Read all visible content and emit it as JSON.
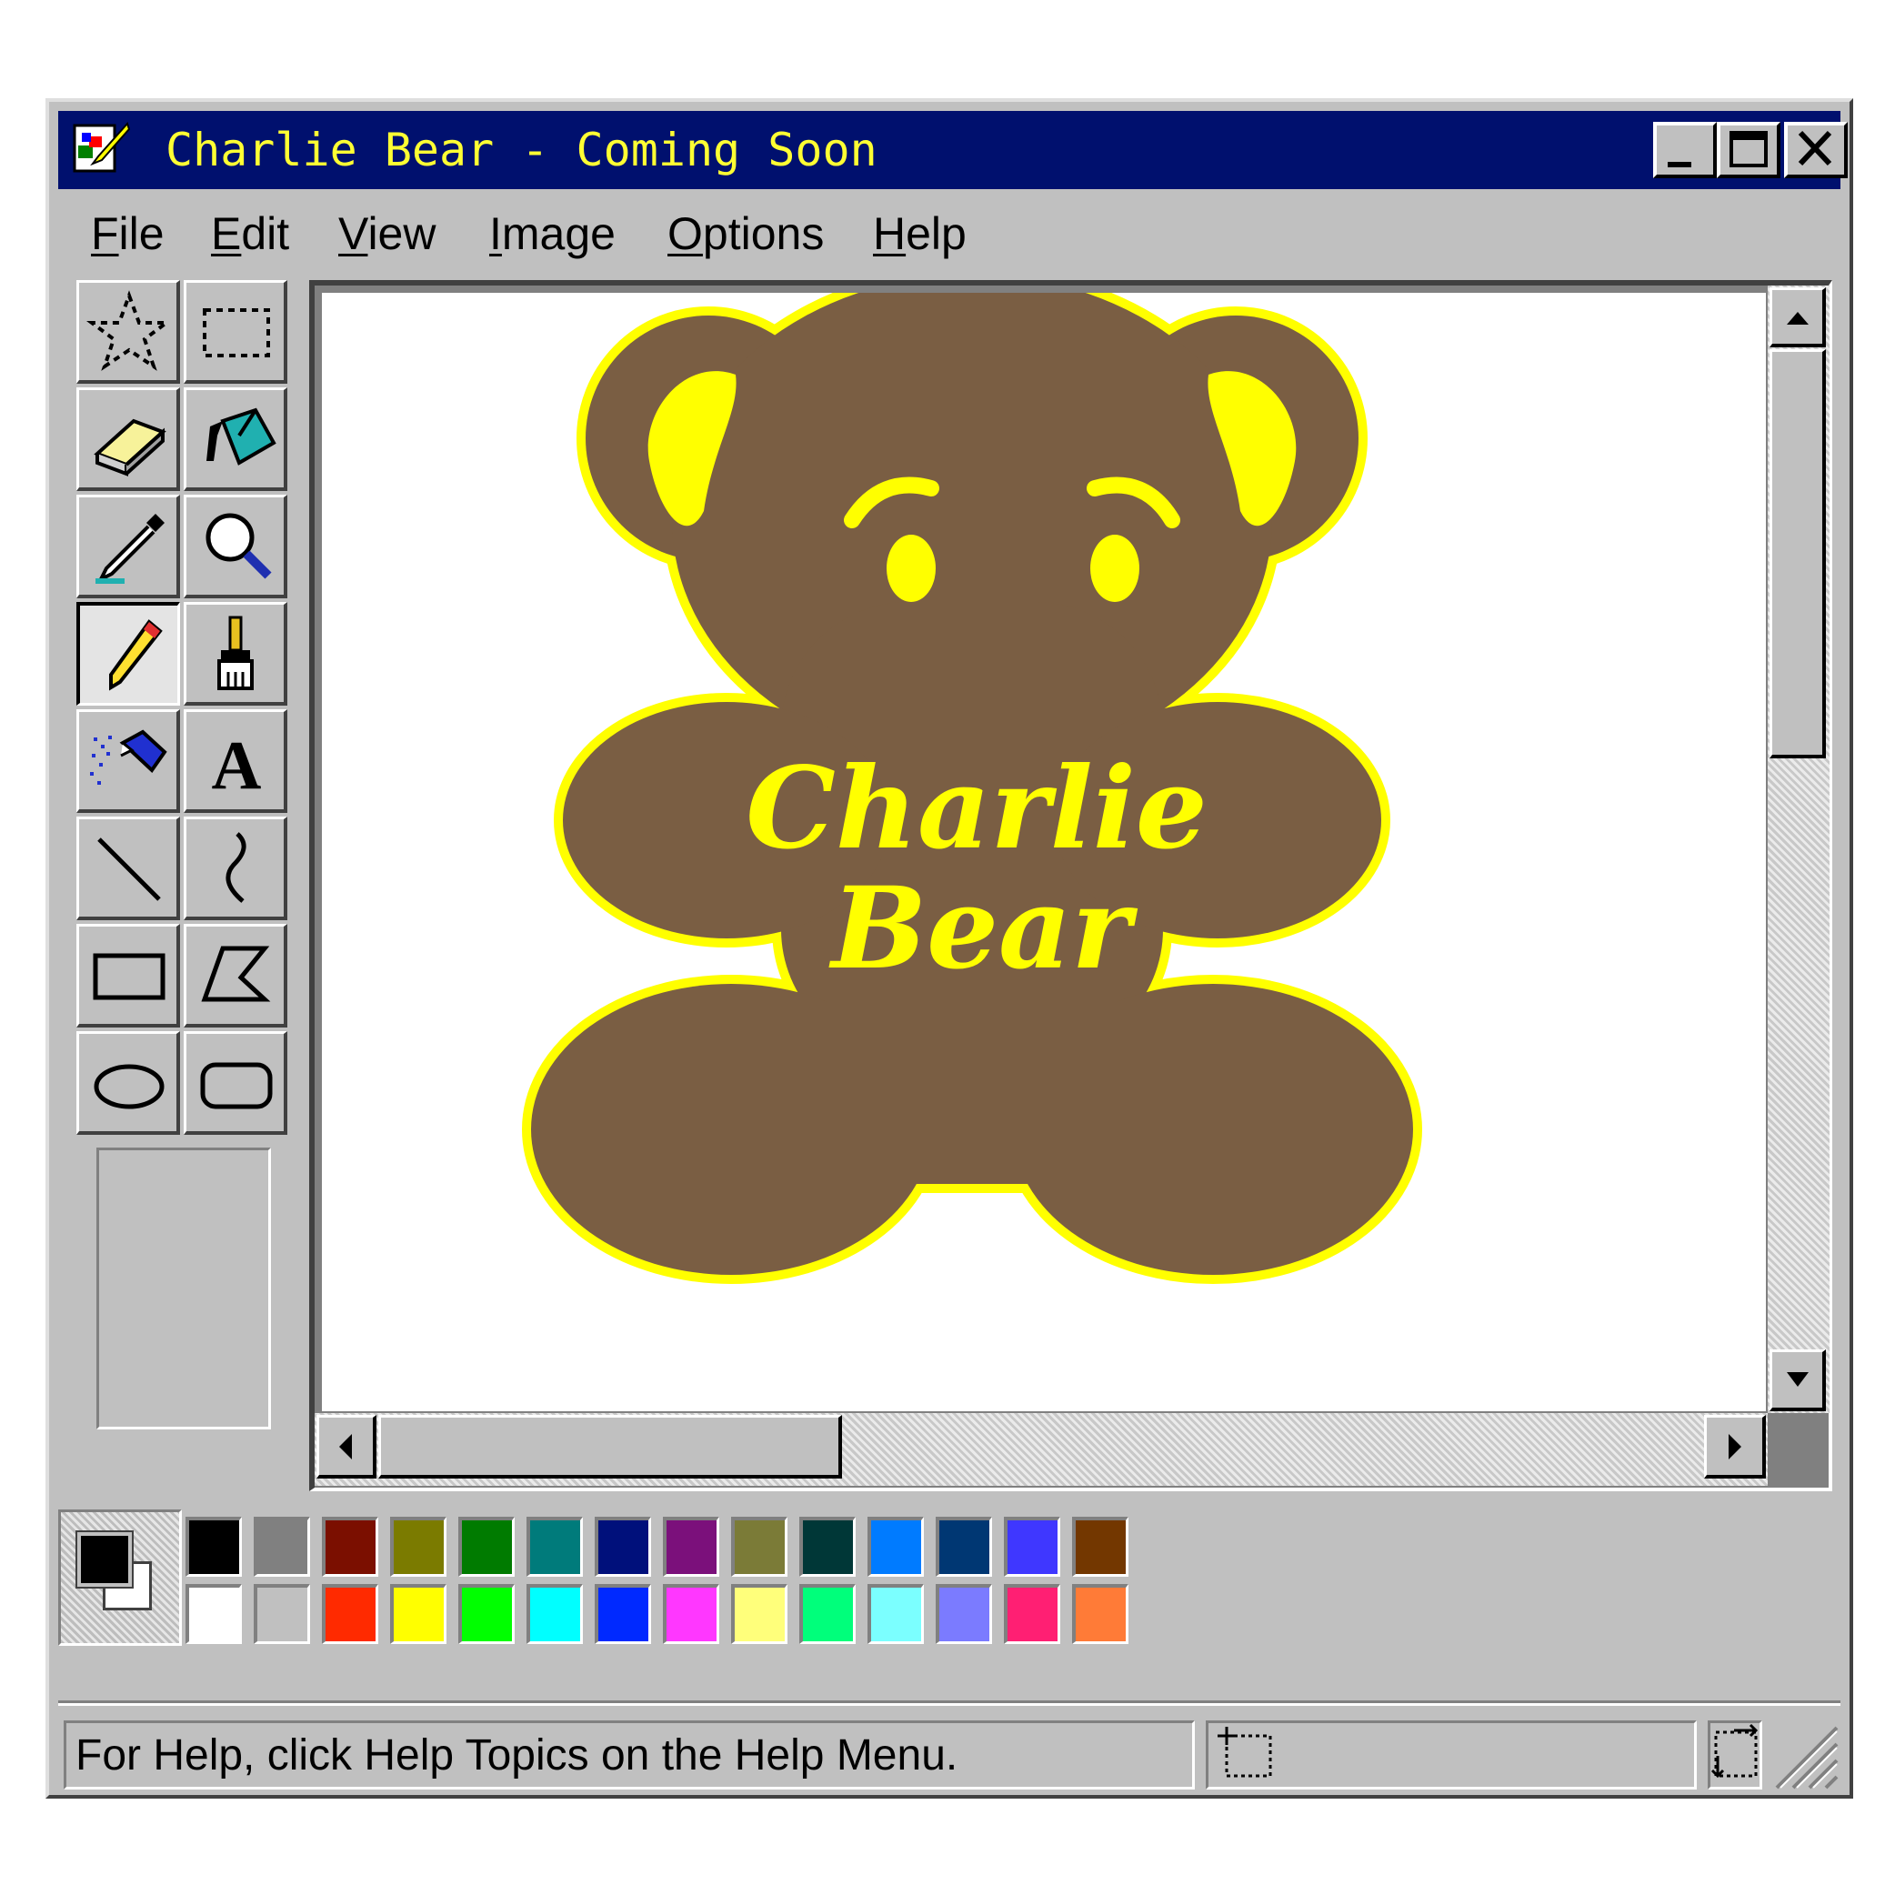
{
  "window": {
    "title": "Charlie Bear - Coming Soon",
    "app_icon": "paint-app-icon",
    "controls": [
      "minimize-icon",
      "maximize-icon",
      "close-icon"
    ]
  },
  "menu": [
    {
      "accel": "F",
      "rest": "ile"
    },
    {
      "accel": "E",
      "rest": "dit"
    },
    {
      "accel": "V",
      "rest": "iew"
    },
    {
      "accel": "I",
      "rest": "mage"
    },
    {
      "accel": "O",
      "rest": "ptions"
    },
    {
      "accel": "H",
      "rest": "elp"
    }
  ],
  "tools": [
    {
      "name": "free-form-select",
      "icon": "star-select-icon"
    },
    {
      "name": "select",
      "icon": "rect-select-icon"
    },
    {
      "name": "eraser",
      "icon": "eraser-icon"
    },
    {
      "name": "fill-with-color",
      "icon": "paint-bucket-icon"
    },
    {
      "name": "pick-color",
      "icon": "eyedropper-icon"
    },
    {
      "name": "magnifier",
      "icon": "magnifier-icon"
    },
    {
      "name": "pencil",
      "icon": "pencil-icon",
      "active": true
    },
    {
      "name": "brush",
      "icon": "brush-icon"
    },
    {
      "name": "airbrush",
      "icon": "airbrush-icon"
    },
    {
      "name": "text",
      "icon": "text-a-icon",
      "glyph": "A"
    },
    {
      "name": "line",
      "icon": "line-icon"
    },
    {
      "name": "curve",
      "icon": "curve-icon"
    },
    {
      "name": "rectangle",
      "icon": "rectangle-icon"
    },
    {
      "name": "polygon",
      "icon": "polygon-icon"
    },
    {
      "name": "ellipse",
      "icon": "ellipse-icon"
    },
    {
      "name": "rounded-rectangle",
      "icon": "rounded-rect-icon"
    }
  ],
  "canvas": {
    "artwork": {
      "line1": "Charlie",
      "line2": "Bear",
      "colors": {
        "fill": "#7a5e43",
        "outline": "#ffff00",
        "accent": "#ffff00"
      }
    }
  },
  "palette": {
    "foreground": "#000000",
    "background": "#ffffff",
    "top_row": [
      "#000000",
      "#808080",
      "#7b0f00",
      "#7b7b00",
      "#007b00",
      "#007b7b",
      "#00107b",
      "#7b107b",
      "#7b7b37",
      "#003737",
      "#007bff",
      "#003773",
      "#3f37ff",
      "#733700"
    ],
    "bottom_row": [
      "#ffffff",
      "#c0c0c0",
      "#ff2a00",
      "#ffff00",
      "#00ff00",
      "#00ffff",
      "#0029ff",
      "#ff37ff",
      "#ffff7b",
      "#00ff7b",
      "#7bffff",
      "#7b7bff",
      "#ff1f73",
      "#ff7b37"
    ]
  },
  "status": {
    "help_text": "For Help, click Help Topics on the Help Menu.",
    "position_icon": "selection-position-icon",
    "size_icon": "selection-size-icon"
  }
}
